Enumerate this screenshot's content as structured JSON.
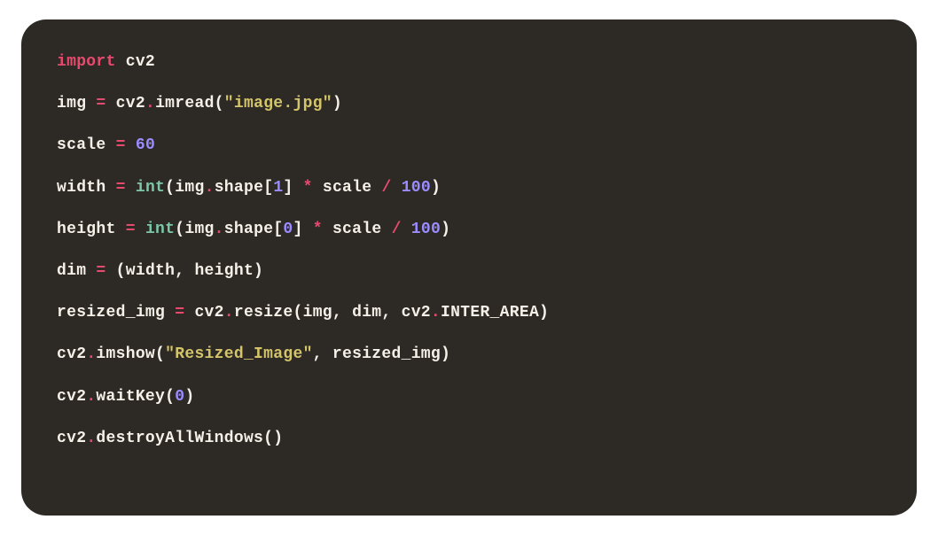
{
  "code": {
    "lines": [
      {
        "tokens": [
          {
            "cls": "tok-keyword",
            "text": "import"
          },
          {
            "cls": "tok-default",
            "text": " cv2"
          }
        ]
      },
      {
        "tokens": [
          {
            "cls": "tok-default",
            "text": "img "
          },
          {
            "cls": "tok-punct",
            "text": "="
          },
          {
            "cls": "tok-default",
            "text": " cv2"
          },
          {
            "cls": "tok-punct",
            "text": "."
          },
          {
            "cls": "tok-default",
            "text": "imread("
          },
          {
            "cls": "tok-string",
            "text": "\"image.jpg\""
          },
          {
            "cls": "tok-default",
            "text": ")"
          }
        ]
      },
      {
        "tokens": [
          {
            "cls": "tok-default",
            "text": "scale "
          },
          {
            "cls": "tok-punct",
            "text": "="
          },
          {
            "cls": "tok-default",
            "text": " "
          },
          {
            "cls": "tok-number",
            "text": "60"
          }
        ]
      },
      {
        "tokens": [
          {
            "cls": "tok-default",
            "text": "width "
          },
          {
            "cls": "tok-punct",
            "text": "="
          },
          {
            "cls": "tok-default",
            "text": " "
          },
          {
            "cls": "tok-builtin",
            "text": "int"
          },
          {
            "cls": "tok-default",
            "text": "(img"
          },
          {
            "cls": "tok-punct",
            "text": "."
          },
          {
            "cls": "tok-default",
            "text": "shape["
          },
          {
            "cls": "tok-number",
            "text": "1"
          },
          {
            "cls": "tok-default",
            "text": "] "
          },
          {
            "cls": "tok-punct",
            "text": "*"
          },
          {
            "cls": "tok-default",
            "text": " scale "
          },
          {
            "cls": "tok-punct",
            "text": "/"
          },
          {
            "cls": "tok-default",
            "text": " "
          },
          {
            "cls": "tok-number",
            "text": "100"
          },
          {
            "cls": "tok-default",
            "text": ")"
          }
        ]
      },
      {
        "tokens": [
          {
            "cls": "tok-default",
            "text": "height "
          },
          {
            "cls": "tok-punct",
            "text": "="
          },
          {
            "cls": "tok-default",
            "text": " "
          },
          {
            "cls": "tok-builtin",
            "text": "int"
          },
          {
            "cls": "tok-default",
            "text": "(img"
          },
          {
            "cls": "tok-punct",
            "text": "."
          },
          {
            "cls": "tok-default",
            "text": "shape["
          },
          {
            "cls": "tok-number",
            "text": "0"
          },
          {
            "cls": "tok-default",
            "text": "] "
          },
          {
            "cls": "tok-punct",
            "text": "*"
          },
          {
            "cls": "tok-default",
            "text": " scale "
          },
          {
            "cls": "tok-punct",
            "text": "/"
          },
          {
            "cls": "tok-default",
            "text": " "
          },
          {
            "cls": "tok-number",
            "text": "100"
          },
          {
            "cls": "tok-default",
            "text": ")"
          }
        ]
      },
      {
        "tokens": [
          {
            "cls": "tok-default",
            "text": "dim "
          },
          {
            "cls": "tok-punct",
            "text": "="
          },
          {
            "cls": "tok-default",
            "text": " (width, height)"
          }
        ]
      },
      {
        "tokens": [
          {
            "cls": "tok-default",
            "text": "resized_img "
          },
          {
            "cls": "tok-punct",
            "text": "="
          },
          {
            "cls": "tok-default",
            "text": " cv2"
          },
          {
            "cls": "tok-punct",
            "text": "."
          },
          {
            "cls": "tok-default",
            "text": "resize(img, dim, cv2"
          },
          {
            "cls": "tok-punct",
            "text": "."
          },
          {
            "cls": "tok-default",
            "text": "INTER_AREA)"
          }
        ]
      },
      {
        "tokens": [
          {
            "cls": "tok-default",
            "text": "cv2"
          },
          {
            "cls": "tok-punct",
            "text": "."
          },
          {
            "cls": "tok-default",
            "text": "imshow("
          },
          {
            "cls": "tok-string",
            "text": "\"Resized_Image\""
          },
          {
            "cls": "tok-default",
            "text": ", resized_img)"
          }
        ]
      },
      {
        "tokens": [
          {
            "cls": "tok-default",
            "text": "cv2"
          },
          {
            "cls": "tok-punct",
            "text": "."
          },
          {
            "cls": "tok-default",
            "text": "waitKey("
          },
          {
            "cls": "tok-number",
            "text": "0"
          },
          {
            "cls": "tok-default",
            "text": ")"
          }
        ]
      },
      {
        "tokens": [
          {
            "cls": "tok-default",
            "text": "cv2"
          },
          {
            "cls": "tok-punct",
            "text": "."
          },
          {
            "cls": "tok-default",
            "text": "destroyAllWindows()"
          }
        ]
      }
    ]
  }
}
